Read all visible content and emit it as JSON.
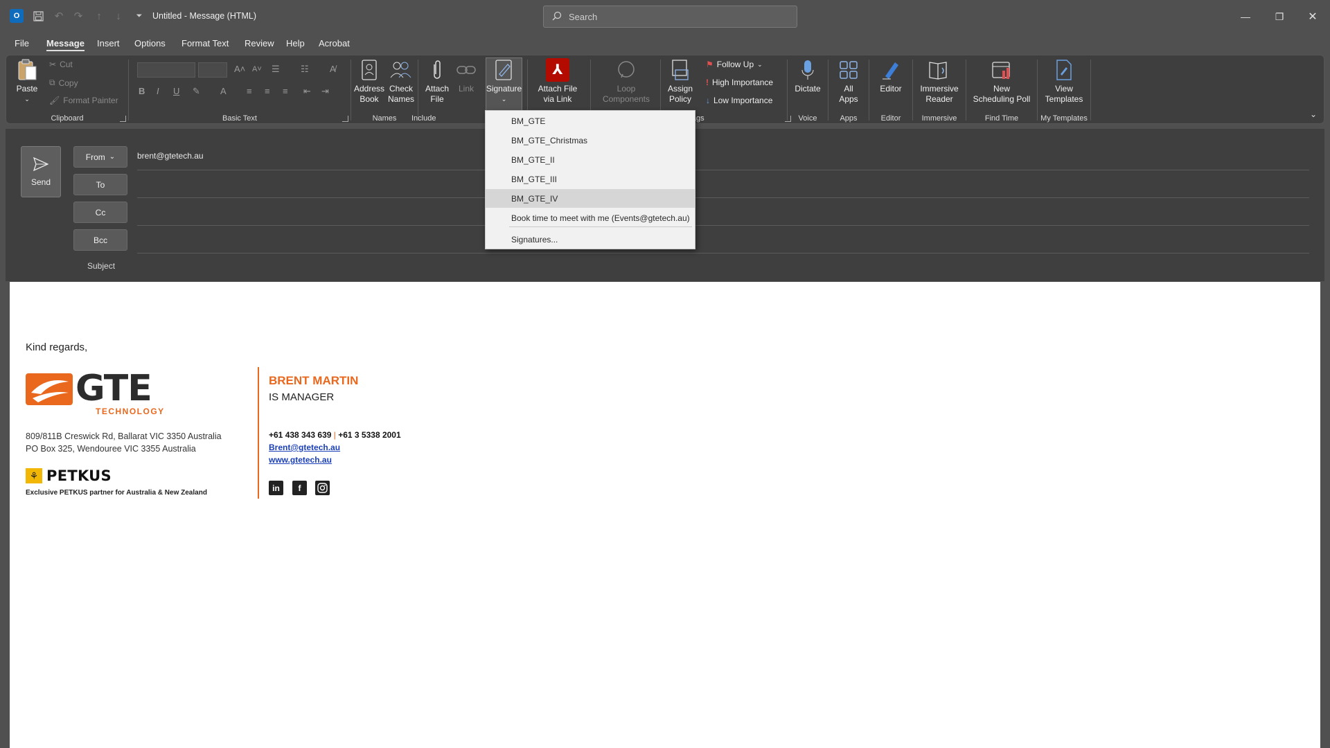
{
  "app": {
    "icon": "outlook-icon"
  },
  "titlebar": {
    "title": "Untitled  -  Message (HTML)",
    "search_placeholder": "Search"
  },
  "menu": {
    "tabs": [
      "File",
      "Message",
      "Insert",
      "Options",
      "Format Text",
      "Review",
      "Help",
      "Acrobat"
    ],
    "active": "Message"
  },
  "ribbon": {
    "clipboard": {
      "label": "Clipboard",
      "paste": "Paste",
      "cut": "Cut",
      "copy": "Copy",
      "format_painter": "Format Painter"
    },
    "basic_text": {
      "label": "Basic Text"
    },
    "names": {
      "label": "Names",
      "address_book": [
        "Address",
        "Book"
      ],
      "check_names": [
        "Check",
        "Names"
      ]
    },
    "include": {
      "label": "Include",
      "attach_file": [
        "Attach",
        "File"
      ],
      "link": "Link",
      "signature": "Signature"
    },
    "acrobat": {
      "attach_via_link": [
        "Attach File",
        "via Link"
      ]
    },
    "loop": {
      "components": [
        "Loop",
        "Components"
      ]
    },
    "policy": {
      "assign": [
        "Assign",
        "Policy"
      ]
    },
    "tags": {
      "label": "Tags",
      "follow_up": "Follow Up",
      "high": "High Importance",
      "low": "Low Importance"
    },
    "voice": {
      "label": "Voice",
      "dictate": "Dictate"
    },
    "apps": {
      "label": "Apps",
      "all_apps": [
        "All",
        "Apps"
      ]
    },
    "editor": {
      "label": "Editor",
      "editor": "Editor"
    },
    "immersive": {
      "label": "Immersive",
      "reader": [
        "Immersive",
        "Reader"
      ]
    },
    "find_time": {
      "label": "Find Time",
      "poll": [
        "New",
        "Scheduling Poll"
      ]
    },
    "templates": {
      "label": "My Templates",
      "view": [
        "View",
        "Templates"
      ]
    }
  },
  "compose": {
    "send": "Send",
    "from_label": "From",
    "from_value": "brent@gtetech.au",
    "to_label": "To",
    "cc_label": "Cc",
    "bcc_label": "Bcc",
    "subject_label": "Subject"
  },
  "signature_menu": {
    "items": [
      "BM_GTE",
      "BM_GTE_Christmas",
      "BM_GTE_II",
      "BM_GTE_III",
      "BM_GTE_IV",
      "Book time to meet with me (Events@gtetech.au)"
    ],
    "highlighted": "BM_GTE_IV",
    "manage": "Signatures..."
  },
  "body": {
    "greeting": "Kind regards,",
    "logo": {
      "text": "GTE",
      "subtext": "TECHNOLOGY"
    },
    "address_1": "809/811B Creswick Rd, Ballarat VIC 3350 Australia",
    "address_2": "PO Box 325, Wendouree VIC 3355 Australia",
    "petkus": "PETKUS",
    "partner": "Exclusive PETKUS partner for Australia & New Zealand",
    "name": "BRENT MARTIN",
    "role": "IS MANAGER",
    "phone_1": "+61 438 343 639",
    "phone_sep": "|",
    "phone_2": "+61 3 5338 2001",
    "email": "Brent@gtetech.au",
    "website": "www.gtetech.au",
    "social": [
      "linkedin-icon",
      "facebook-icon",
      "instagram-icon"
    ]
  },
  "colors": {
    "accent": "#e9681e",
    "link": "#1a3fb8",
    "ribbon_bg": "#3e3e3e",
    "chrome_bg": "#505050"
  }
}
